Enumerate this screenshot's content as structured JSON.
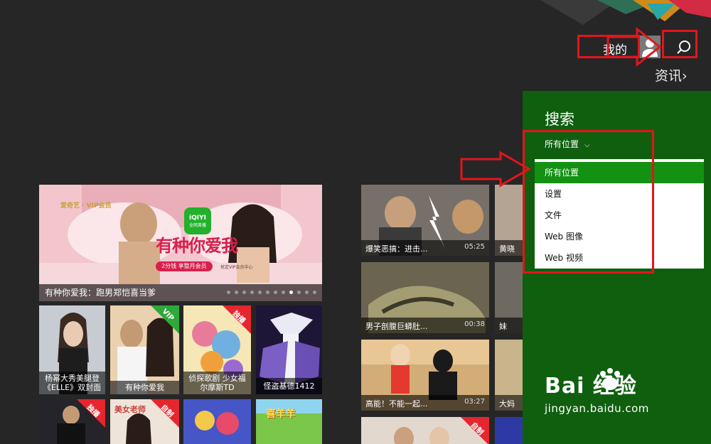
{
  "header": {
    "user_label": "我的",
    "news_label": "资讯",
    "news_chevron": "›"
  },
  "hero": {
    "caption": "有种你爱我：跑男郑恺喜当爹",
    "brand": "爱奇艺 · VIP会员",
    "title_art": "有种你爱我",
    "logo": "iQIYI",
    "logo_sub": "全网首播",
    "pill": "2分钱 享整月会员",
    "pill_sub": "抢定VIP会员中心",
    "dot_count": 12,
    "active_dot": 8
  },
  "tiles_row1": [
    {
      "caption": "杨幂大秀美腿登《ELLE》双封面",
      "badge": ""
    },
    {
      "caption": "有种你爱我",
      "badge": "VIP"
    },
    {
      "caption": "侦探歌剧 少女福尔摩斯TD",
      "badge": "独播"
    },
    {
      "caption": "怪盗基德1412",
      "badge": ""
    }
  ],
  "tiles_row2": [
    {
      "badge": "独播",
      "label": ""
    },
    {
      "badge": "自制",
      "label": "美女老师"
    },
    {
      "badge": "",
      "label": ""
    },
    {
      "badge": "",
      "label": "喜羊羊"
    }
  ],
  "videos": [
    {
      "title": "爆笑恶搞：进击...",
      "duration": "05:25"
    },
    {
      "title": "男子剖腹巨蟒肚...",
      "duration": "00:38"
    },
    {
      "title": "高能！不能一起...",
      "duration": "03:27"
    },
    {
      "title": "",
      "duration": ""
    }
  ],
  "videos_col2": [
    {
      "title": "黄晓明"
    },
    {
      "title": "妹子！"
    },
    {
      "title": "大妈隆"
    },
    {
      "title": ""
    }
  ],
  "video_badge": "自制",
  "search_pane": {
    "title": "搜索",
    "scope_label": "所有位置",
    "scope_chevron": "⌵",
    "options": [
      "所有位置",
      "设置",
      "文件",
      "Web 图像",
      "Web 视频"
    ],
    "selected": 0
  },
  "watermark": {
    "main": "Bai 经验",
    "sub": "jingyan.baidu.com"
  },
  "colors": {
    "background": "#262626",
    "pane": "#0f5f0f",
    "selected": "#139113",
    "annotation": "#e3151c"
  }
}
